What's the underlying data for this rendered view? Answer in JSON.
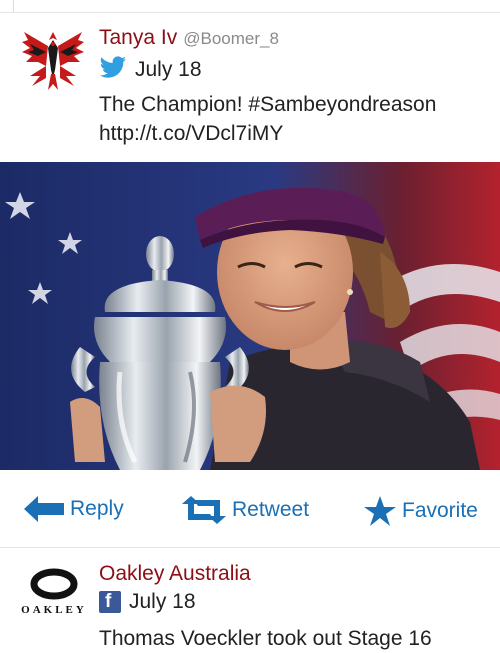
{
  "timeline": [
    {
      "author": "Tanya Iv",
      "handle": "@Boomer_8",
      "source_icon": "twitter-bird-icon",
      "date": "July 18",
      "text_line1": "The Champion! #Sambeyondreason",
      "text_line2": "http://t.co/VDcl7iMY"
    },
    {
      "author": "Oakley Australia",
      "source_icon": "facebook-icon",
      "date": "July 18",
      "text": "Thomas Voeckler took out Stage 16",
      "logo_text": "OAKLEY"
    }
  ],
  "actions": {
    "reply": "Reply",
    "retweet": "Retweet",
    "favorite": "Favorite"
  },
  "colors": {
    "author": "#8b0f14",
    "action": "#1a6fb5",
    "twitter": "#2f9fe0",
    "facebook": "#3b5998"
  }
}
